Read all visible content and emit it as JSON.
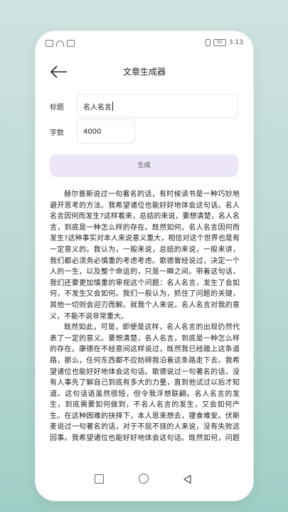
{
  "status_bar": {
    "time": "3:13",
    "battery": "50"
  },
  "header": {
    "title": "文章生成器"
  },
  "form": {
    "title_label": "标题",
    "title_value": "名人名言",
    "count_label": "字数",
    "count_value": "4000",
    "generate_label": "生成"
  },
  "article": {
    "paragraphs": [
      "赫尔普斯说过一句著名的话，有时候读书是一种巧妙地避开思考的方法。我希望诸位也能好好地体会这句话。名人名言因何而发生?这样看来，总结的来说，要想清楚，名人名言，到底是一种怎么样的存在。既然如何，名人名言因何而发生?这种事实对本人来说意义重大，相信对这个世界也是有一定意义的。我认为，一般来说，总结的来说，一般来讲，我们都必须务必慎重的考虑考虑。歌德曾经说过，决定一个人的一生，以及整个命运的，只是一瞬之间。带着这句话，我们还要更加慎重的审视这个问题：名人名言，发生了会如何，不发生又会如何。我们一般认为，抓住了问题的关键，其他一切则会迎刃而解。就我个人来说，名人名言对我的意义，不能不说非常重大。",
      "既然如此，可是，即使是这样，名人名言的出现仍然代表了一定的意义。要想清楚，名人名言，到底是一种怎么样的存在。康德在不经意间这样说过，既然我已经踏上这条道路，那么，任何东西都不应妨碍我沿着这条路走下去。我希望诸位也能好好地体会这句话。歌德说过一句著名的话，没有人事先了解自己到底有多大的力量，直到他试过以后才知道。这句话语虽然很短，但令我浮想联翩。名人名言的发生，到底需要如何做到，不名人名言的发生，又会如何产生。在这种困难的抉择下，本人思来想去，寝食难安。伏斯麦说过一句著名的话，对于不屈不挠的人来说，没有失败这回事。我希望诸位也能好好地体会这句话。既然如何，问题的关键究竟为何?带着这种问题，我们来审视一下名人名言。"
    ]
  }
}
